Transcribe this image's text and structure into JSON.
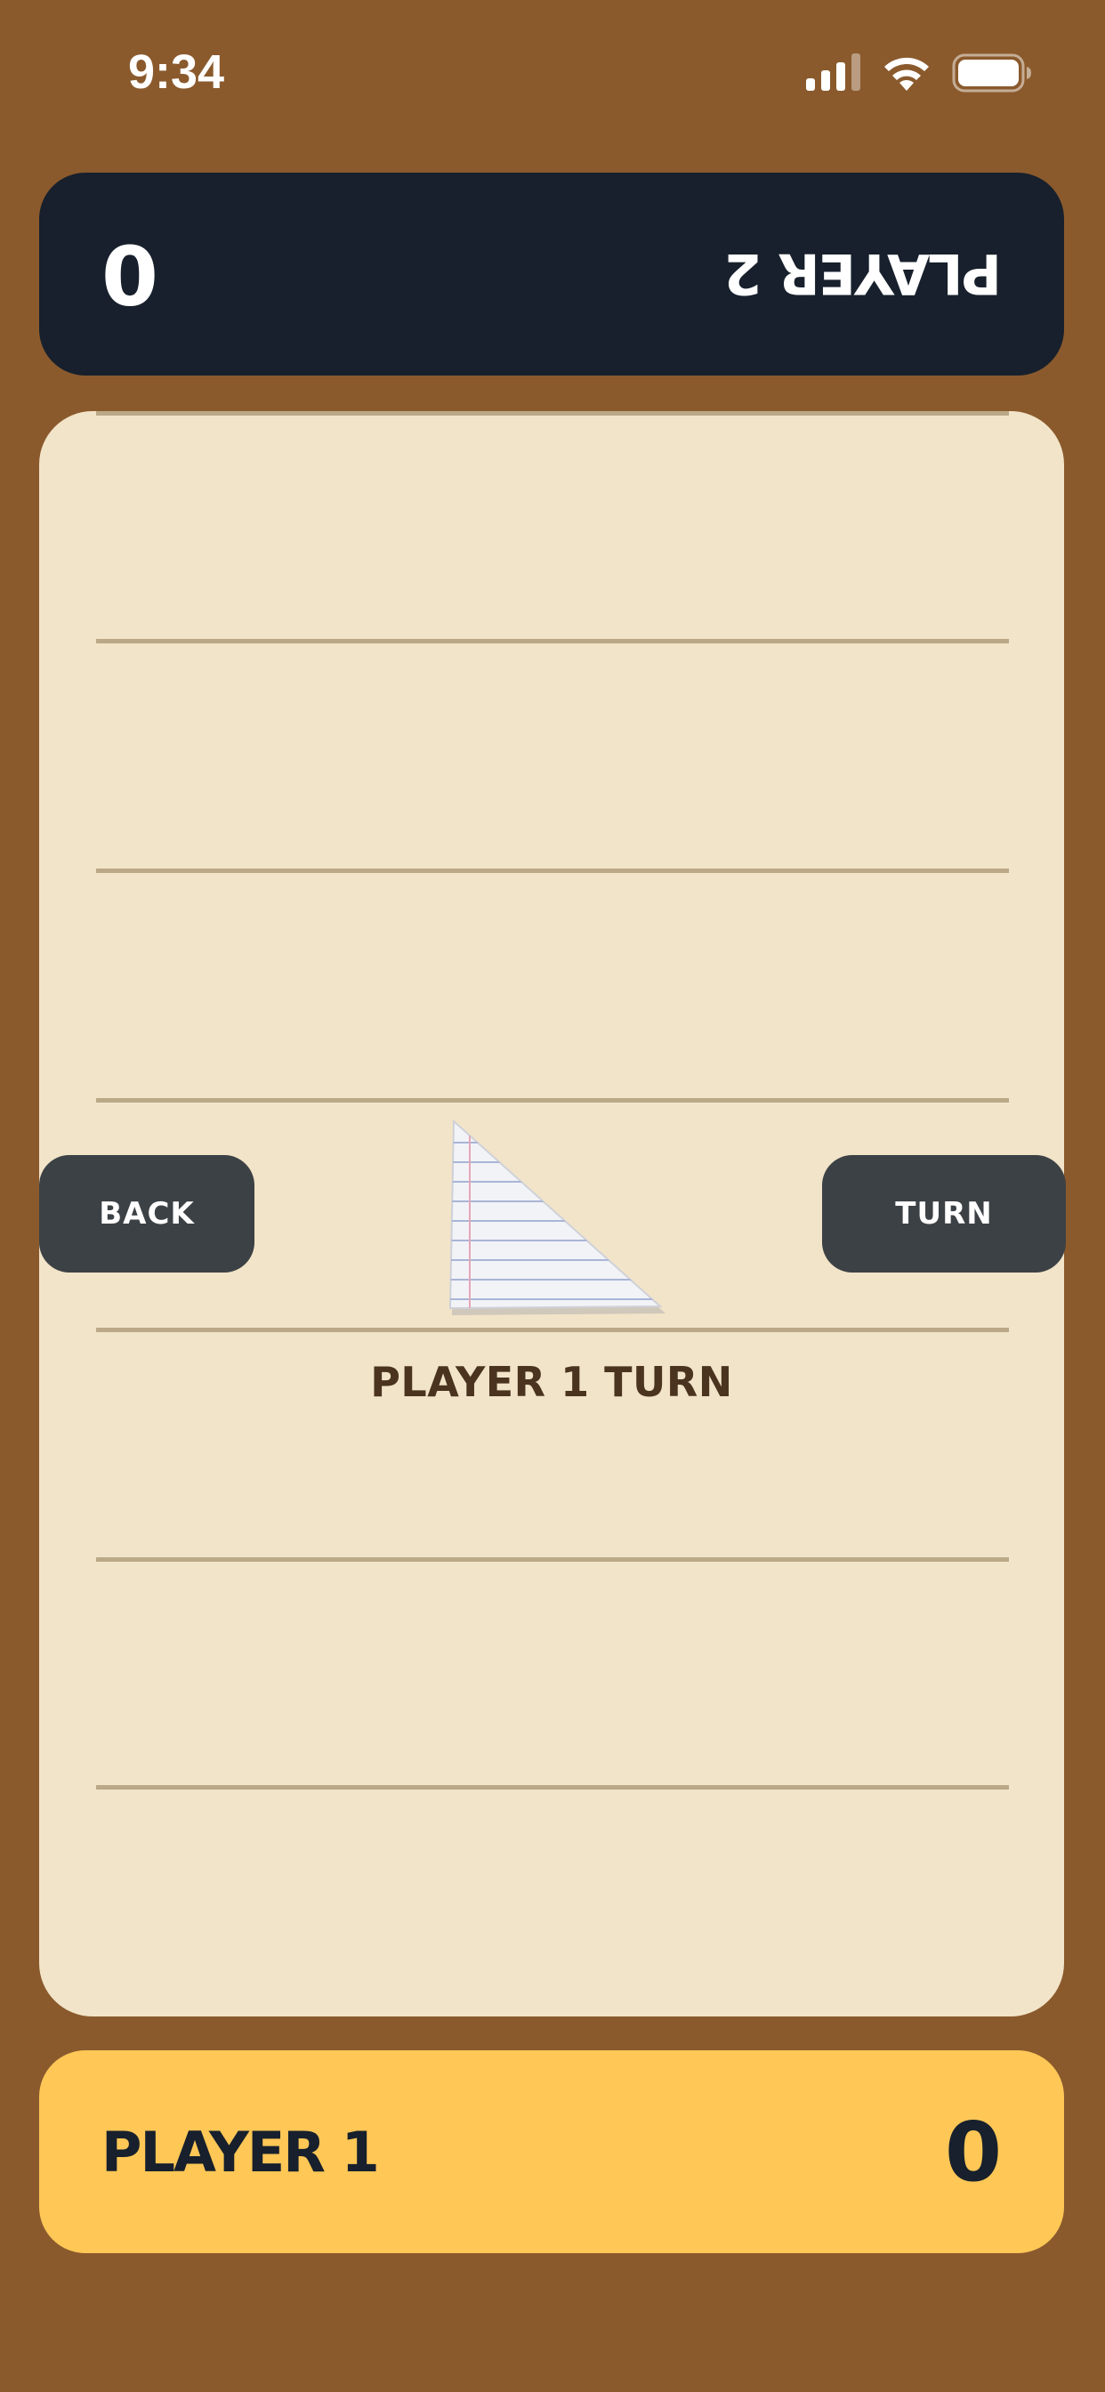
{
  "status_bar": {
    "time": "9:34",
    "icons": [
      "signal-icon",
      "wifi-icon",
      "battery-icon"
    ]
  },
  "player2": {
    "name": "PLAYER 2",
    "score": "0",
    "card_color": "#17202c",
    "orientation": "upside-down"
  },
  "player1": {
    "name": "PLAYER 1",
    "score": "0",
    "card_color": "#fec756"
  },
  "board": {
    "background": "#f2e4c8",
    "turn_text": "PLAYER 1 TURN",
    "piece": "paper-triangle"
  },
  "buttons": {
    "back_label": "BACK",
    "turn_label": "TURN"
  },
  "colors": {
    "background": "#8a5a2d",
    "button": "#3c4145"
  }
}
